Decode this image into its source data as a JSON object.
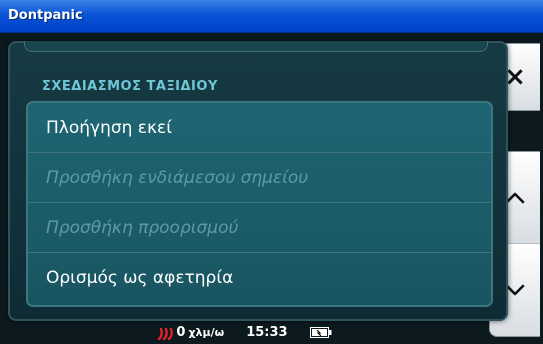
{
  "window": {
    "title": "Dontpanic"
  },
  "side_buttons": {
    "close_label": "×"
  },
  "menu": {
    "heading": "ΣΧΕΔΙΑΣΜΟΣ ΤΑΞΙΔΙΟΥ",
    "items": [
      {
        "label": "Πλοήγηση εκεί",
        "enabled": true
      },
      {
        "label": "Προσθήκη ενδιάμεσου σημείου",
        "enabled": false
      },
      {
        "label": "Προσθήκη προορισμού",
        "enabled": false
      },
      {
        "label": "Ορισμός ως αφετηρία",
        "enabled": true
      }
    ]
  },
  "status": {
    "speed": "0",
    "speed_unit": "χλμ/ω",
    "time": "15:33",
    "signal_icon": "gps-signal-icon",
    "battery_icon": "battery-charging-icon"
  },
  "colors": {
    "heading": "#6fc7d6",
    "disabled_text": "#5f99a5",
    "signal": "#e0202a"
  }
}
